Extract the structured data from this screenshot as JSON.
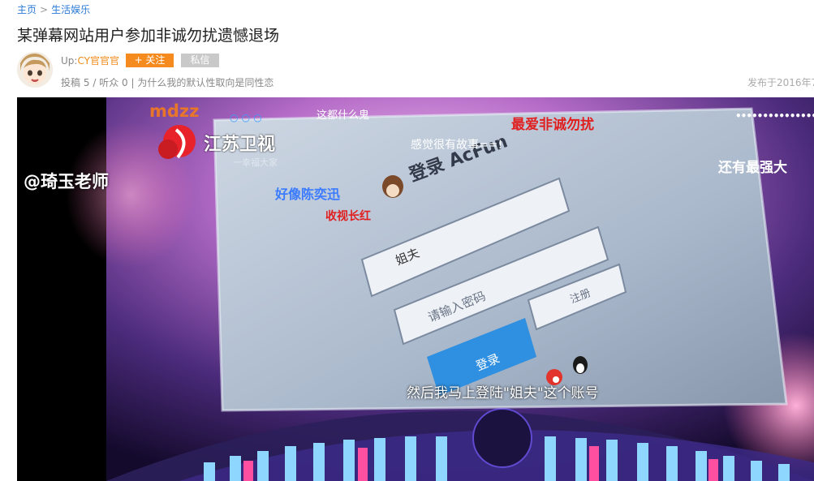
{
  "breadcrumb": {
    "home": "主页",
    "separator": ">",
    "category": "生活娱乐"
  },
  "title": "某弹幕网站用户参加非诚勿扰遗憾退场",
  "uploader": {
    "label": "Up:",
    "name": "CY官官官",
    "follow_label": "+ 关注",
    "message_label": "私信"
  },
  "stats": {
    "posts_label": "投稿",
    "posts": "5",
    "sep1": "/",
    "listeners_label": "听众",
    "listeners": "0",
    "sep2": "|",
    "signature": "为什么我的默认性取向是同性恋"
  },
  "publish_date": "发布于2016年7",
  "video": {
    "tv_logo_text": "江苏卫视",
    "tv_slogan": "一幸福大家",
    "screen_login_title": "登录 AcFun",
    "screen_username_value": "姐夫",
    "screen_password_placeholder": "请输入密码",
    "screen_login_button": "登录",
    "screen_register_button": "注册",
    "danmaku": [
      {
        "text": "mdzz",
        "color": "#e8762a"
      },
      {
        "text": "这都什么鬼",
        "color": "#ffffff"
      },
      {
        "text": "最爱非诚勿扰",
        "color": "#e02020"
      },
      {
        "text": "感觉很有故事==!",
        "color": "#ffffff"
      },
      {
        "text": "@琦玉老师",
        "color": "#ffffff"
      },
      {
        "text": "好像陈奕迅",
        "color": "#3a7bff"
      },
      {
        "text": "收视长红",
        "color": "#e02020"
      },
      {
        "text": "还有最强大",
        "color": "#ffffff"
      },
      {
        "text": "○ ○ ○",
        "color": "#3aa0ff"
      },
      {
        "text": "••••••••••••••••••",
        "color": "#ffffff"
      }
    ],
    "subtitle": "然后我马上登陆\"姐夫\"这个账号"
  }
}
